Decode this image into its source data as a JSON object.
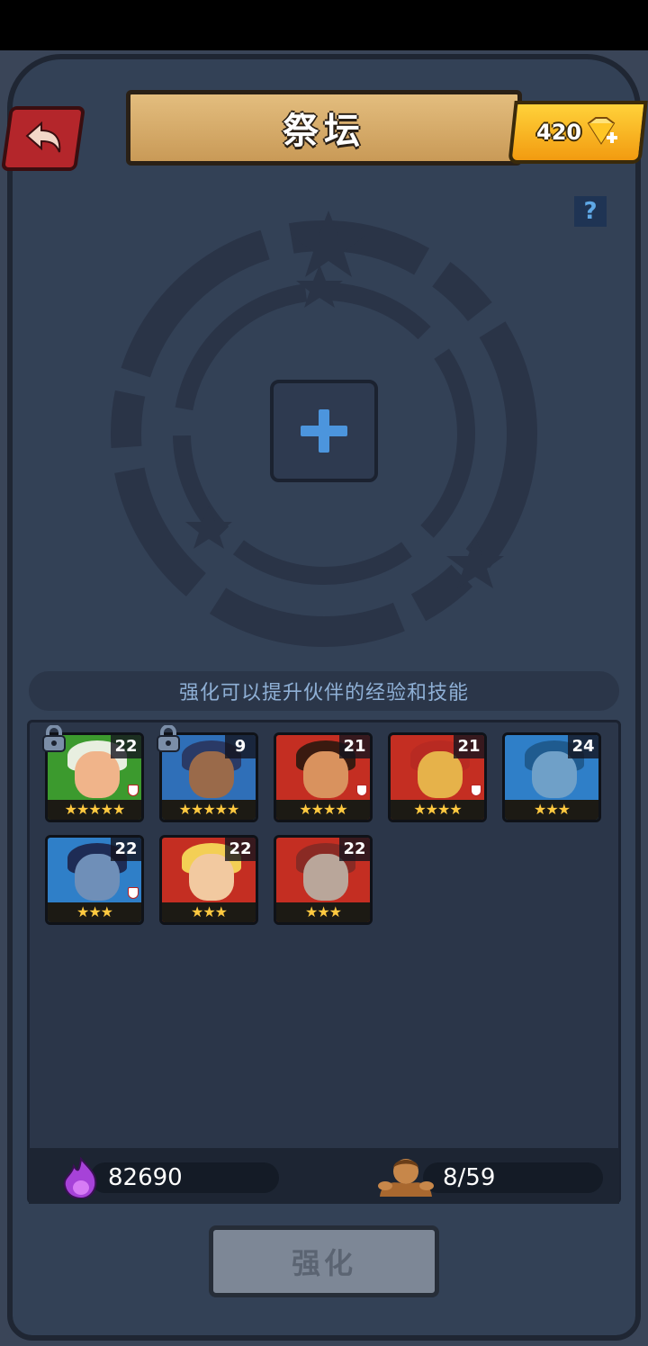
{
  "header": {
    "title": "祭坛",
    "gems": "420",
    "help_label": "?"
  },
  "altar": {
    "hint": "强化可以提升伙伴的经验和技能"
  },
  "heroes": [
    {
      "level": "22",
      "stars": "★★★★★",
      "locked": true,
      "bg": "#3c9a2e"
    },
    {
      "level": "9",
      "stars": "★★★★★",
      "locked": true,
      "bg": "#2f6fb8"
    },
    {
      "level": "21",
      "stars": "★★★★",
      "locked": false,
      "bg": "#c42e22"
    },
    {
      "level": "21",
      "stars": "★★★★",
      "locked": false,
      "bg": "#c42e22"
    },
    {
      "level": "24",
      "stars": "★★★",
      "locked": false,
      "bg": "#2f7fc8"
    },
    {
      "level": "22",
      "stars": "★★★",
      "locked": false,
      "bg": "#2f7fc8"
    },
    {
      "level": "22",
      "stars": "★★★",
      "locked": false,
      "bg": "#c42e22"
    },
    {
      "level": "22",
      "stars": "★★★",
      "locked": false,
      "bg": "#c42e22"
    }
  ],
  "footer": {
    "essence": "82690",
    "hero_count": "8/59"
  },
  "actions": {
    "enhance_label": "强化"
  },
  "colors": {
    "accent_gold": "#f2a31a",
    "back_red": "#b4262b",
    "plus_blue": "#4c95dd",
    "disabled_gray": "#7d8796"
  }
}
